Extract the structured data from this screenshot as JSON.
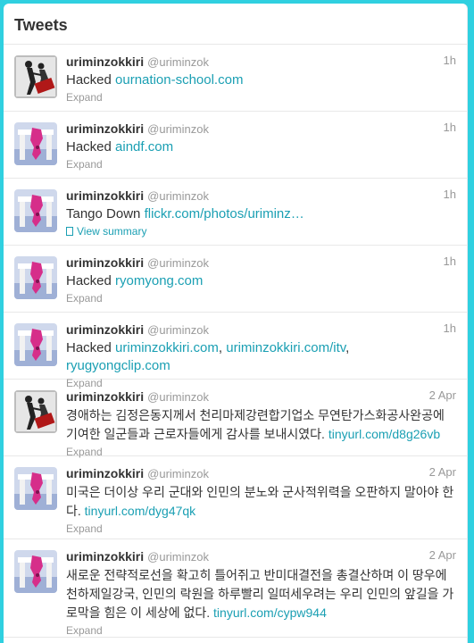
{
  "panel": {
    "title": "Tweets"
  },
  "colors": {
    "accent": "#1a9fb3",
    "frame": "#2fd0e0"
  },
  "tweets": [
    {
      "name": "uriminzokkiri",
      "handle": "@uriminzok",
      "time": "1h",
      "avatar": "tango-down-dancers-icon",
      "text": "Hacked ",
      "links": [
        "ournation-school.com"
      ],
      "action": "Expand"
    },
    {
      "name": "uriminzokkiri",
      "handle": "@uriminzok",
      "time": "1h",
      "avatar": "korea-map-gate-icon",
      "text": "Hacked ",
      "links": [
        "aindf.com"
      ],
      "action": "Expand"
    },
    {
      "name": "uriminzokkiri",
      "handle": "@uriminzok",
      "time": "1h",
      "avatar": "korea-map-gate-icon",
      "text": "Tango Down ",
      "links": [
        "flickr.com/photos/uriminz…"
      ],
      "action": "View summary"
    },
    {
      "name": "uriminzokkiri",
      "handle": "@uriminzok",
      "time": "1h",
      "avatar": "korea-map-gate-icon",
      "text": "Hacked  ",
      "links": [
        "ryomyong.com"
      ],
      "action": "Expand"
    },
    {
      "name": "uriminzokkiri",
      "handle": "@uriminzok",
      "time": "1h",
      "avatar": "korea-map-gate-icon",
      "text": "Hacked ",
      "links": [
        "uriminzokkiri.com",
        "uriminzokkiri.com/itv",
        "ryugyongclip.com"
      ],
      "separators": [
        ", ",
        ", "
      ],
      "action": "Expand"
    },
    {
      "name": "uriminzokkiri",
      "handle": "@uriminzok",
      "time": "2 Apr",
      "avatar": "tango-down-dancers-icon",
      "text": "경애하는 김정은동지께서 천리마제강련합기업소 무연탄가스화공사완공에 기여한 일군들과 근로자들에게 감사를 보내시였다.        ",
      "links": [
        "tinyurl.com/d8g26vb"
      ],
      "action": "Expand"
    },
    {
      "name": "uriminzokkiri",
      "handle": "@uriminzok",
      "time": "2 Apr",
      "avatar": "korea-map-gate-icon",
      "text": "미국은 더이상 우리 군대와 인민의 분노와 군사적위력을 오판하지 말아야 한다. ",
      "links": [
        "tinyurl.com/dyg47qk"
      ],
      "action": "Expand"
    },
    {
      "name": "uriminzokkiri",
      "handle": "@uriminzok",
      "time": "2 Apr",
      "avatar": "korea-map-gate-icon",
      "text": "새로운 전략적로선을 확고히 틀어쥐고 반미대결전을 총결산하며 이 땅우에 천하제일강국, 인민의 락원을 하루빨리 일떠세우려는 우리 인민의 앞길을 가로막을 힘은 이 세상에 없다.     ",
      "links": [
        "tinyurl.com/cypw944"
      ],
      "action": "Expand"
    }
  ]
}
